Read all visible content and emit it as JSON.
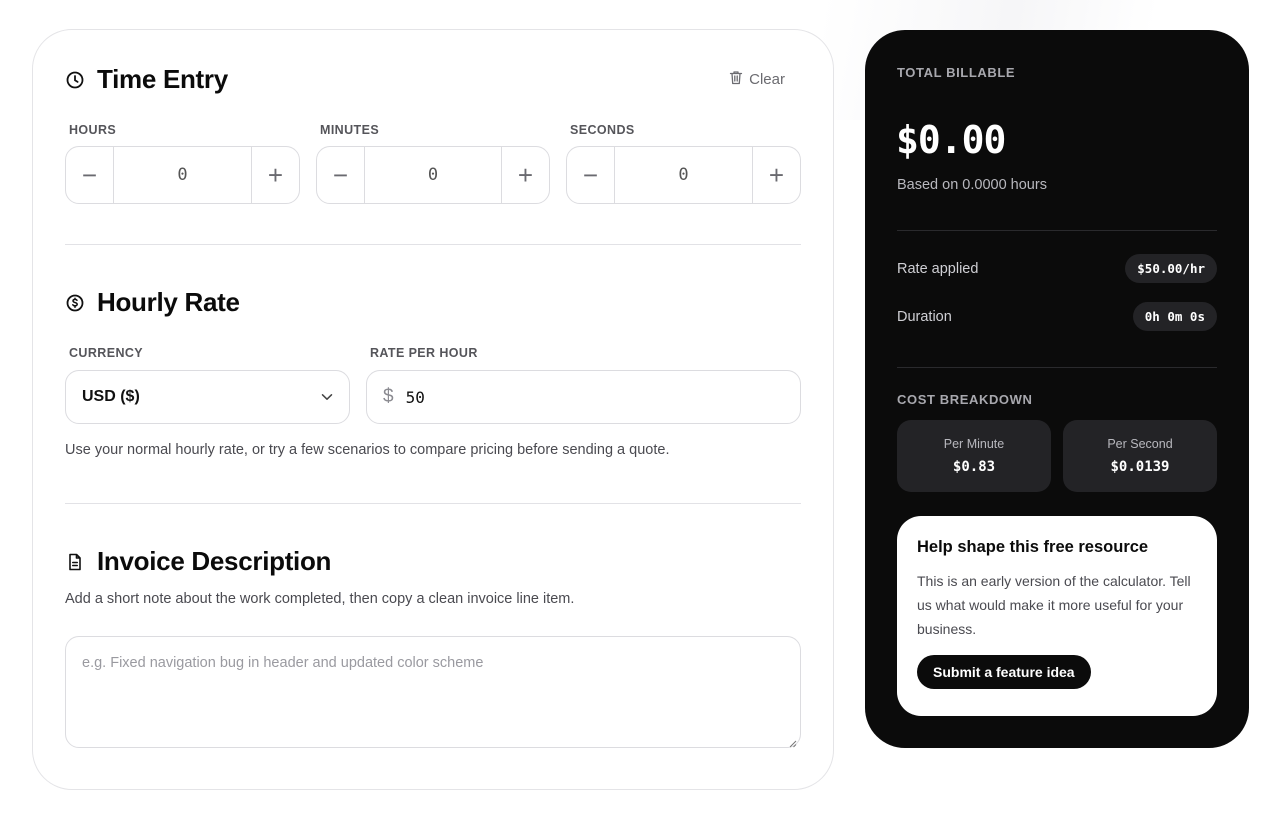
{
  "time_entry": {
    "title": "Time Entry",
    "clear_label": "Clear",
    "hours": {
      "label": "HOURS",
      "value": "0"
    },
    "minutes": {
      "label": "MINUTES",
      "value": "0"
    },
    "seconds": {
      "label": "SECONDS",
      "value": "0"
    }
  },
  "hourly_rate": {
    "title": "Hourly Rate",
    "currency_label": "CURRENCY",
    "currency_value": "USD ($)",
    "rate_label": "RATE PER HOUR",
    "rate_symbol": "$",
    "rate_value": "50",
    "help_text": "Use your normal hourly rate, or try a few scenarios to compare pricing before sending a quote."
  },
  "invoice": {
    "title": "Invoice Description",
    "subtitle": "Add a short note about the work completed, then copy a clean invoice line item.",
    "placeholder": "e.g. Fixed navigation bug in header and updated color scheme"
  },
  "summary": {
    "total_label": "TOTAL BILLABLE",
    "total_amount": "$0.00",
    "based_on": "Based on 0.0000 hours",
    "rate_applied_label": "Rate applied",
    "rate_applied_value": "$50.00/hr",
    "duration_label": "Duration",
    "duration_value": "0h 0m 0s",
    "breakdown_label": "COST BREAKDOWN",
    "per_minute_label": "Per Minute",
    "per_minute_value": "$0.83",
    "per_second_label": "Per Second",
    "per_second_value": "$0.0139"
  },
  "feedback": {
    "title": "Help shape this free resource",
    "body": "This is an early version of the calculator. Tell us what would make it more useful for your business.",
    "button_label": "Submit a feature idea"
  },
  "icons": {
    "time_entry": "clock-icon",
    "clear": "trash-icon",
    "hourly_rate": "dollar-circle-icon",
    "invoice": "document-icon",
    "select": "chevron-down-icon",
    "decrement": "minus-icon",
    "increment": "plus-icon"
  },
  "colors": {
    "panel_bg": "#0b0b0b",
    "pill_bg": "#232326",
    "border": "#dcdce0"
  }
}
